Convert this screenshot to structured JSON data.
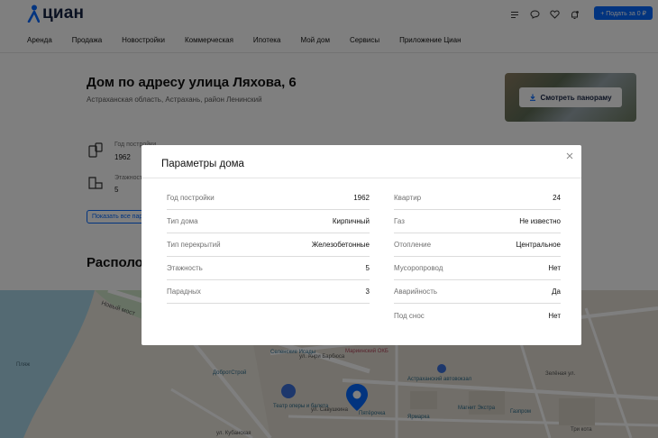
{
  "header": {
    "logo_text": "циан",
    "post_button": "+ Подать за 0 ₽",
    "icons": [
      "list-icon",
      "chat-icon",
      "heart-icon",
      "bell-icon"
    ]
  },
  "nav": {
    "items": [
      {
        "label": "Аренда"
      },
      {
        "label": "Продажа"
      },
      {
        "label": "Новостройки"
      },
      {
        "label": "Коммерческая"
      },
      {
        "label": "Ипотека"
      },
      {
        "label": "Мой дом"
      },
      {
        "label": "Сервисы"
      },
      {
        "label": "Приложение Циан"
      }
    ]
  },
  "page": {
    "title": "Дом по адресу улица Ляхова, 6",
    "subtitle": "Астраханская область, Астрахань, район Ленинский",
    "panorama_button": "Смотреть панораму",
    "facts": [
      {
        "label": "Год постройки",
        "value": "1962"
      },
      {
        "label": "Этажность",
        "value": "5"
      }
    ],
    "show_all_button": "Показать все параметры",
    "section_title": "Расположение"
  },
  "map": {
    "labels": [
      "Новый мост",
      "Селенские Исады",
      "Мариинский ОКБ",
      "ДобротСтрой",
      "Театр оперы и балета",
      "Астраханский автовокзал",
      "Ярмарка",
      "Магнит Экстра",
      "Газпром",
      "Пятёрочка",
      "Три кота",
      "Пляж",
      "ул. Анри Барбюса",
      "Зелёная ул.",
      "ул. Савушкина",
      "ул. Кубанская"
    ]
  },
  "modal": {
    "title": "Параметры дома",
    "left": [
      {
        "label": "Год постройки",
        "value": "1962"
      },
      {
        "label": "Тип дома",
        "value": "Кирпичный"
      },
      {
        "label": "Тип перекрытий",
        "value": "Железобетонные"
      },
      {
        "label": "Этажность",
        "value": "5"
      },
      {
        "label": "Парадных",
        "value": "3"
      }
    ],
    "right": [
      {
        "label": "Квартир",
        "value": "24"
      },
      {
        "label": "Газ",
        "value": "Не известно"
      },
      {
        "label": "Отопление",
        "value": "Центральное"
      },
      {
        "label": "Мусоропровод",
        "value": "Нет"
      },
      {
        "label": "Аварийность",
        "value": "Да"
      },
      {
        "label": "Под снос",
        "value": "Нет"
      }
    ]
  },
  "colors": {
    "brand": "#0468ff",
    "logo": "#152242",
    "overlay": "rgba(0,0,0,0.5)"
  }
}
